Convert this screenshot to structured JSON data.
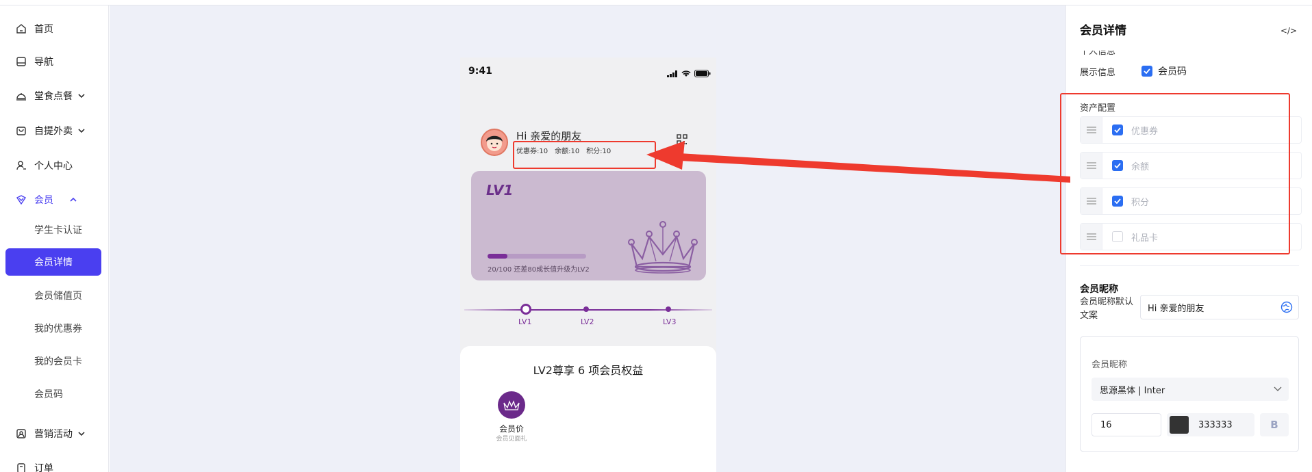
{
  "sidebar": {
    "items": [
      {
        "label": "首页",
        "icon": "home-icon"
      },
      {
        "label": "导航",
        "icon": "nav-icon"
      },
      {
        "label": "堂食点餐",
        "icon": "dine-icon"
      },
      {
        "label": "自提外卖",
        "icon": "takeout-icon"
      },
      {
        "label": "个人中心",
        "icon": "user-icon"
      },
      {
        "label": "会员",
        "icon": "member-icon"
      },
      {
        "label": "营销活动",
        "icon": "marketing-icon"
      },
      {
        "label": "订单",
        "icon": "order-icon"
      }
    ],
    "member_sub": [
      "学生卡认证",
      "会员详情",
      "会员储值页",
      "我的优惠券",
      "我的会员卡",
      "会员码"
    ]
  },
  "phone": {
    "time": "9:41",
    "greeting": "Hi 亲爱的朋友",
    "assets": [
      "优惠券:10",
      "余额:10",
      "积分:10"
    ],
    "card": {
      "level": "LV1",
      "progress": 0.2,
      "progress_text": "20/100 还差80成长值升级为LV2"
    },
    "levels": [
      "LV1",
      "LV2",
      "LV3"
    ],
    "benefits_title": "LV2尊享 6 项会员权益",
    "benefit": {
      "name": "会员价",
      "sub": "会员见面礼"
    }
  },
  "panel": {
    "title": "会员详情",
    "collapse_icon": "</>",
    "cut_label": "个人信息",
    "show_info_label": "展示信息",
    "show_info_option": "会员码",
    "asset_config_label": "资产配置",
    "asset_rows": [
      {
        "label": "优惠券",
        "checked": true
      },
      {
        "label": "余额",
        "checked": true
      },
      {
        "label": "积分",
        "checked": true
      },
      {
        "label": "礼品卡",
        "checked": false
      }
    ],
    "nickname_section": "会员昵称",
    "nickname_default_label": "会员昵称默认文案",
    "nickname_value": "Hi 亲爱的朋友",
    "style_label": "会员昵称",
    "font_value": "思源黑体 | Inter",
    "font_size": "16",
    "color_hex": "333333",
    "bold_label": "B"
  },
  "colors": {
    "accent": "#4a3ff0",
    "member_purple": "#7a2e98",
    "highlight_red": "#ee3a2e",
    "checkbox_blue": "#2b6ef2"
  }
}
